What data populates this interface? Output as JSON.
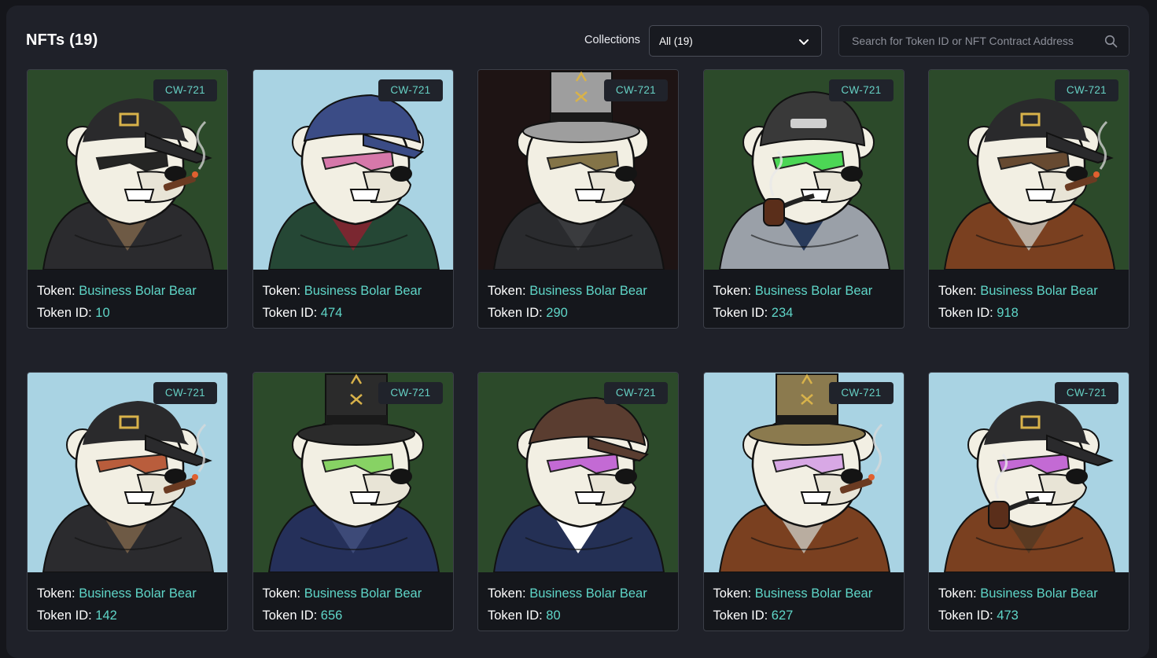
{
  "header": {
    "title": "NFTs (19)",
    "collections_label": "Collections",
    "collections_selected": "All (19)",
    "search_placeholder": "Search for Token ID or NFT Contract Address"
  },
  "token_label": "Token:",
  "token_id_label": "Token ID:",
  "cards": [
    {
      "badge": "CW-721",
      "token": "Business Bolar Bear",
      "token_id": "10",
      "bg": "#2c4a2a",
      "hat": "cap",
      "hat_color": "#2a2a2c",
      "glasses": "#141414",
      "jacket": "#2b2b2e",
      "shirt": "#6e5a45",
      "smoke": "cigar"
    },
    {
      "badge": "CW-721",
      "token": "Business Bolar Bear",
      "token_id": "474",
      "bg": "#a9d3e3",
      "hat": "flat",
      "hat_color": "#3b4c86",
      "glasses": "#d46ea6",
      "jacket": "#254735",
      "shirt": "#7a2730",
      "smoke": "none"
    },
    {
      "badge": "CW-721",
      "token": "Business Bolar Bear",
      "token_id": "290",
      "bg": "#1e1414",
      "hat": "top",
      "hat_color": "#9e9e9e",
      "glasses": "#7b6a3b",
      "jacket": "#2a2b2e",
      "shirt": "#3a3b3e",
      "smoke": "none"
    },
    {
      "badge": "CW-721",
      "token": "Business Bolar Bear",
      "token_id": "234",
      "bg": "#2c4a2a",
      "hat": "beanie",
      "hat_color": "#393939",
      "glasses": "#3fd44a",
      "jacket": "#9aa0a8",
      "shirt": "#283a5a",
      "smoke": "pipe"
    },
    {
      "badge": "CW-721",
      "token": "Business Bolar Bear",
      "token_id": "918",
      "bg": "#2c4a2a",
      "hat": "cap",
      "hat_color": "#2a2a2c",
      "glasses": "#5c3d22",
      "jacket": "#7a4020",
      "shirt": "#b9ada0",
      "smoke": "cigar"
    },
    {
      "badge": "CW-721",
      "token": "Business Bolar Bear",
      "token_id": "142",
      "bg": "#a9d3e3",
      "hat": "cap",
      "hat_color": "#2a2a2c",
      "glasses": "#b5512e",
      "jacket": "#2b2b2e",
      "shirt": "#6e5a45",
      "smoke": "cigar"
    },
    {
      "badge": "CW-721",
      "token": "Business Bolar Bear",
      "token_id": "656",
      "bg": "#2c4a2a",
      "hat": "top",
      "hat_color": "#2b2b2b",
      "glasses": "#7fd05a",
      "jacket": "#25305a",
      "shirt": "#3d4a78",
      "smoke": "none"
    },
    {
      "badge": "CW-721",
      "token": "Business Bolar Bear",
      "token_id": "80",
      "bg": "#2c4a2a",
      "hat": "flat",
      "hat_color": "#5a3d30",
      "glasses": "#c05fd3",
      "jacket": "#243055",
      "shirt": "#ffffff",
      "smoke": "none"
    },
    {
      "badge": "CW-721",
      "token": "Business Bolar Bear",
      "token_id": "627",
      "bg": "#a9d3e3",
      "hat": "top",
      "hat_color": "#8b7a4e",
      "glasses": "#d6a3e6",
      "jacket": "#7a4020",
      "shirt": "#b9ada0",
      "smoke": "cigar"
    },
    {
      "badge": "CW-721",
      "token": "Business Bolar Bear",
      "token_id": "473",
      "bg": "#a9d3e3",
      "hat": "cap",
      "hat_color": "#2a2a2c",
      "glasses": "#c05fd3",
      "jacket": "#7a4020",
      "shirt": "#5a3a22",
      "smoke": "pipe"
    }
  ]
}
